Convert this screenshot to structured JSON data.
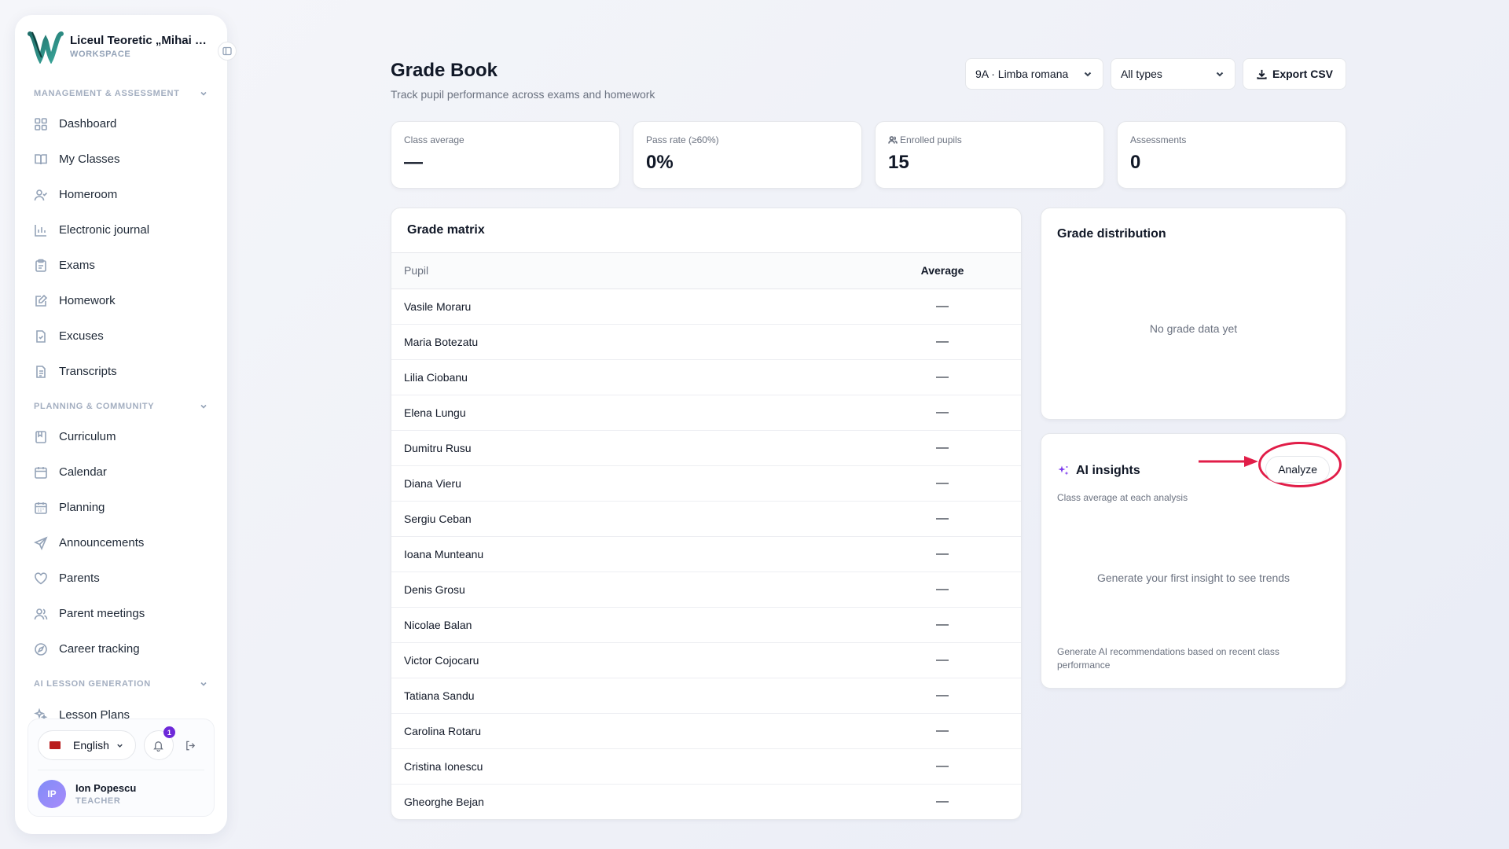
{
  "brand": {
    "name": "Liceul Teoretic „Mihai Emi...",
    "sub": "WORKSPACE"
  },
  "sidebar": {
    "sections": [
      {
        "title": "MANAGEMENT & ASSESSMENT",
        "items": [
          {
            "label": "Dashboard",
            "icon": "grid-icon"
          },
          {
            "label": "My Classes",
            "icon": "book-open-icon"
          },
          {
            "label": "Homeroom",
            "icon": "user-check-icon"
          },
          {
            "label": "Electronic journal",
            "icon": "bar-chart-icon"
          },
          {
            "label": "Exams",
            "icon": "clipboard-icon"
          },
          {
            "label": "Homework",
            "icon": "edit-icon"
          },
          {
            "label": "Excuses",
            "icon": "file-check-icon"
          },
          {
            "label": "Transcripts",
            "icon": "file-text-icon"
          }
        ]
      },
      {
        "title": "PLANNING & COMMUNITY",
        "items": [
          {
            "label": "Curriculum",
            "icon": "book-icon"
          },
          {
            "label": "Calendar",
            "icon": "calendar-icon"
          },
          {
            "label": "Planning",
            "icon": "calendar-days-icon"
          },
          {
            "label": "Announcements",
            "icon": "send-icon"
          },
          {
            "label": "Parents",
            "icon": "heart-icon"
          },
          {
            "label": "Parent meetings",
            "icon": "users-icon"
          },
          {
            "label": "Career tracking",
            "icon": "compass-icon"
          }
        ]
      },
      {
        "title": "AI LESSON GENERATION",
        "items": [
          {
            "label": "Lesson Plans",
            "icon": "sparkles-icon"
          }
        ]
      }
    ],
    "footer": {
      "language": "English",
      "notification_count": "1",
      "user_initials": "IP",
      "user_name": "Ion Popescu",
      "user_role": "TEACHER"
    }
  },
  "header": {
    "title": "Grade Book",
    "subtitle": "Track pupil performance across exams and homework",
    "class_select": "9A · Limba romana",
    "type_select": "All types",
    "export_label": "Export CSV"
  },
  "stats": [
    {
      "label": "Class average",
      "value": "—"
    },
    {
      "label": "Pass rate (≥60%)",
      "value": "0%"
    },
    {
      "label": "Enrolled pupils",
      "value": "15"
    },
    {
      "label": "Assessments",
      "value": "0"
    }
  ],
  "matrix": {
    "title": "Grade matrix",
    "columns": [
      "Pupil",
      "Average"
    ],
    "rows": [
      {
        "pupil": "Vasile Moraru",
        "average": "—"
      },
      {
        "pupil": "Maria Botezatu",
        "average": "—"
      },
      {
        "pupil": "Lilia Ciobanu",
        "average": "—"
      },
      {
        "pupil": "Elena Lungu",
        "average": "—"
      },
      {
        "pupil": "Dumitru Rusu",
        "average": "—"
      },
      {
        "pupil": "Diana Vieru",
        "average": "—"
      },
      {
        "pupil": "Sergiu Ceban",
        "average": "—"
      },
      {
        "pupil": "Ioana Munteanu",
        "average": "—"
      },
      {
        "pupil": "Denis Grosu",
        "average": "—"
      },
      {
        "pupil": "Nicolae Balan",
        "average": "—"
      },
      {
        "pupil": "Victor Cojocaru",
        "average": "—"
      },
      {
        "pupil": "Tatiana Sandu",
        "average": "—"
      },
      {
        "pupil": "Carolina Rotaru",
        "average": "—"
      },
      {
        "pupil": "Cristina Ionescu",
        "average": "—"
      },
      {
        "pupil": "Gheorghe Bejan",
        "average": "—"
      }
    ]
  },
  "distribution": {
    "title": "Grade distribution",
    "empty": "No grade data yet"
  },
  "ai": {
    "title": "AI insights",
    "analyze_label": "Analyze",
    "subtitle": "Class average at each analysis",
    "empty": "Generate your first insight to see trends",
    "footer": "Generate AI recommendations based on recent class performance"
  },
  "colors": {
    "accent": "#6d28d9",
    "annotation": "#e11d48",
    "ai_icon": "#7c3aed"
  }
}
